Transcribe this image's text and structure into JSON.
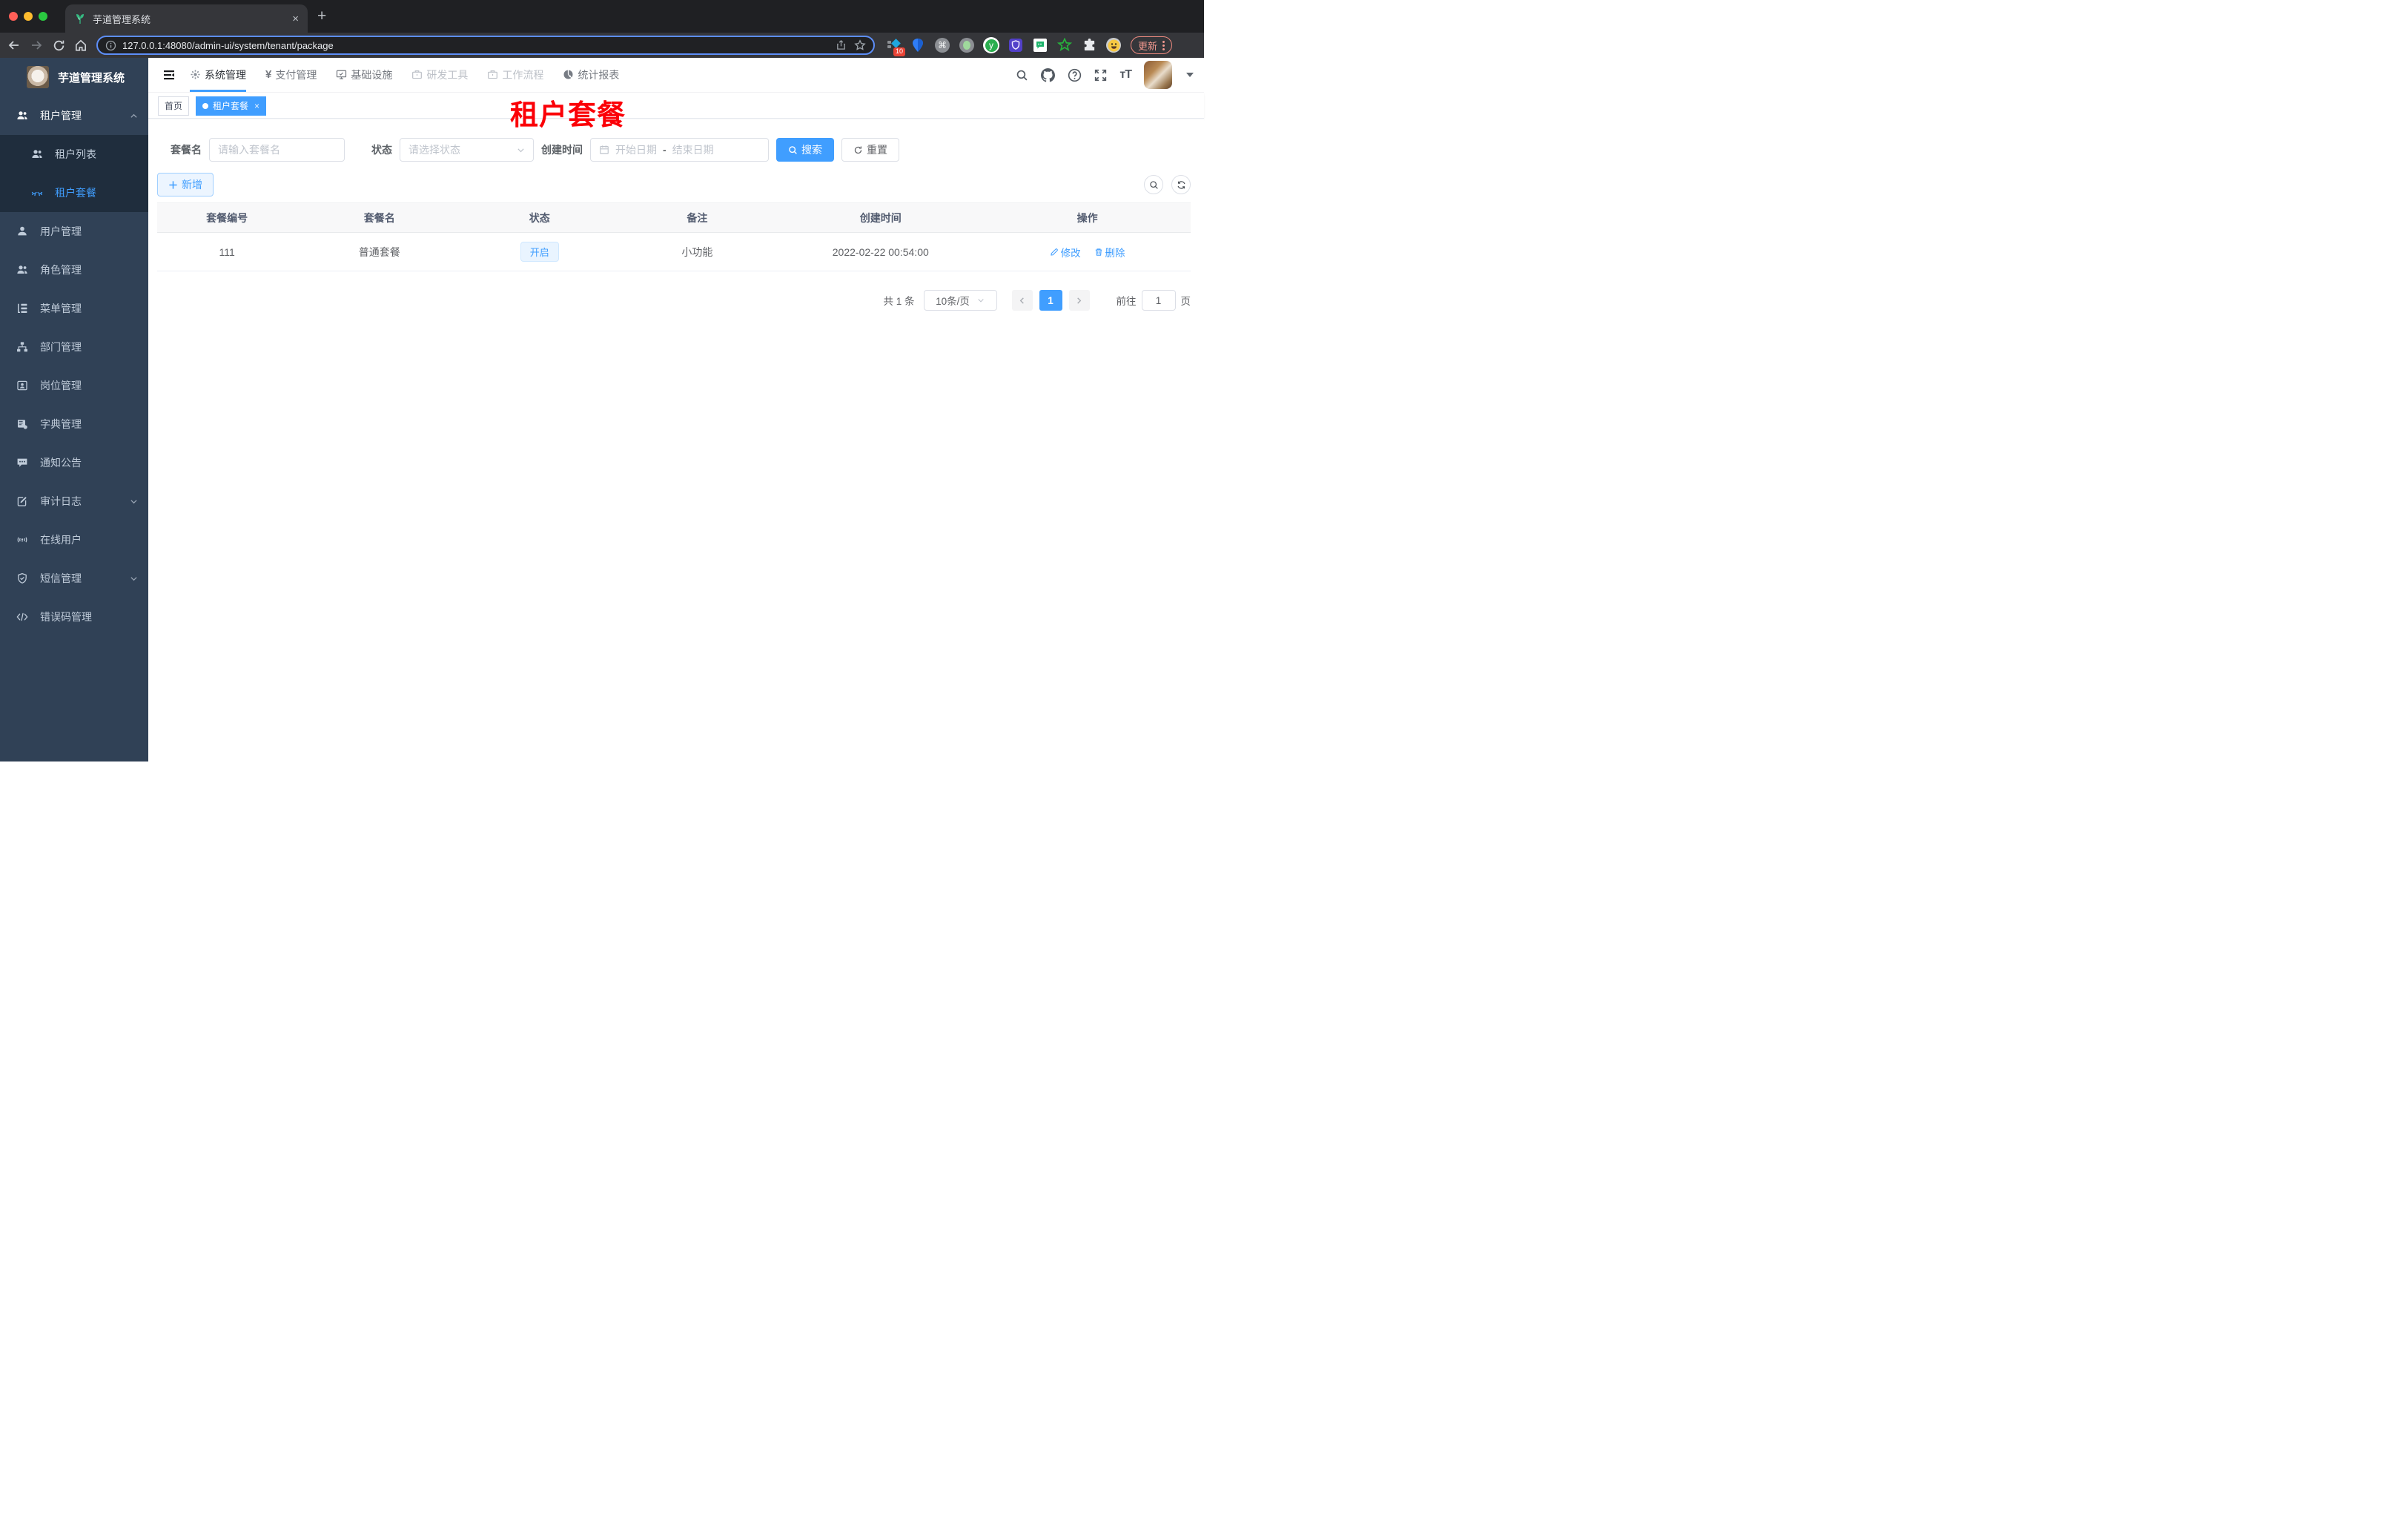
{
  "colors": {
    "accent": "#409eff",
    "sidebar_bg": "#304156",
    "submenu_bg": "#1f2d3d",
    "watermark_red": "#fb0007"
  },
  "browser": {
    "tab_title": "芋道管理系统",
    "tab_close": "×",
    "new_tab": "+",
    "url": "127.0.0.1:48080/admin-ui/system/tenant/package",
    "extension_badge": "10",
    "cmd_glyph": "⌘",
    "y_glyph": "y",
    "update_label": "更新"
  },
  "header": {
    "nav": [
      {
        "label": "系统管理",
        "icon": "gear-icon"
      },
      {
        "label": "支付管理",
        "icon": "yen-icon",
        "yen": "¥"
      },
      {
        "label": "基础设施",
        "icon": "monitor-icon"
      },
      {
        "label": "研发工具",
        "icon": "toolbox-icon"
      },
      {
        "label": "工作流程",
        "icon": "workflow-icon"
      },
      {
        "label": "统计报表",
        "icon": "pie-icon"
      }
    ],
    "font_size_icon": "тT"
  },
  "sidebar": {
    "title": "芋道管理系统",
    "items": [
      {
        "label": "租户管理",
        "icon": "people-icon"
      },
      {
        "label": "租户列表",
        "icon": "people-icon"
      },
      {
        "label": "租户套餐",
        "icon": "eyelash-icon"
      },
      {
        "label": "用户管理",
        "icon": "person-icon"
      },
      {
        "label": "角色管理",
        "icon": "people-icon"
      },
      {
        "label": "菜单管理",
        "icon": "tree-list-icon"
      },
      {
        "label": "部门管理",
        "icon": "org-icon"
      },
      {
        "label": "岗位管理",
        "icon": "badge-icon"
      },
      {
        "label": "字典管理",
        "icon": "book-gear-icon"
      },
      {
        "label": "通知公告",
        "icon": "chat-icon"
      },
      {
        "label": "审计日志",
        "icon": "edit-log-icon"
      },
      {
        "label": "在线用户",
        "icon": "online-icon"
      },
      {
        "label": "短信管理",
        "icon": "shield-icon"
      },
      {
        "label": "错误码管理",
        "icon": "code-icon"
      }
    ]
  },
  "tags": {
    "home": "首页",
    "active": "租户套餐",
    "close": "×"
  },
  "page": {
    "watermark": "租户套餐"
  },
  "filters": {
    "name_label": "套餐名",
    "name_placeholder": "请输入套餐名",
    "status_label": "状态",
    "status_placeholder": "请选择状态",
    "date_label": "创建时间",
    "date_start": "开始日期",
    "date_sep": "-",
    "date_end": "结束日期",
    "search": "搜索",
    "reset": "重置"
  },
  "toolbar": {
    "add": "新增"
  },
  "table": {
    "headers": [
      "套餐编号",
      "套餐名",
      "状态",
      "备注",
      "创建时间",
      "操作"
    ],
    "rows": [
      {
        "id": "111",
        "name": "普通套餐",
        "status": "开启",
        "remark": "小功能",
        "created": "2022-02-22 00:54:00",
        "edit": "修改",
        "delete": "删除"
      }
    ]
  },
  "pagination": {
    "total": "共 1 条",
    "page_size": "10条/页",
    "current": "1",
    "goto": "前往",
    "goto_value": "1",
    "unit": "页"
  }
}
